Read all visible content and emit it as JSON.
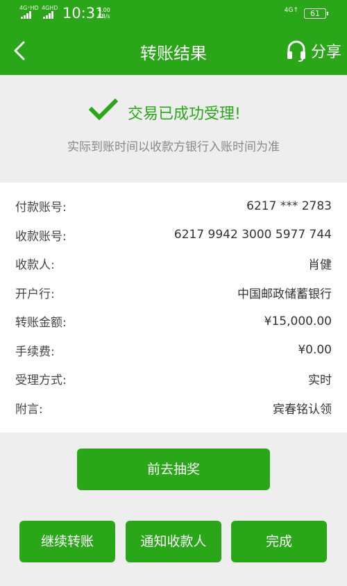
{
  "status_bar": {
    "net1": "4G⁺HD",
    "net2": "4GHD",
    "time": "10:31",
    "speed_value": "4.00",
    "speed_unit": "KB/s",
    "right_net": "4G↑",
    "battery": "61"
  },
  "nav": {
    "back_icon": "chevron-left-icon",
    "title": "转账结果",
    "share_icon": "headset-icon",
    "share_label": "分享"
  },
  "result": {
    "title": "交易已成功受理!",
    "subtitle": "实际到账时间以收款方银行入账时间为准",
    "status_color": "#2aa718"
  },
  "details": [
    {
      "label": "付款账号:",
      "value": "6217 *** 2783"
    },
    {
      "label": "收款账号:",
      "value": "6217 9942 3000 5977 744"
    },
    {
      "label": "收款人:",
      "value": "肖健"
    },
    {
      "label": "开户行:",
      "value": "中国邮政储蓄银行"
    },
    {
      "label": "转账金额:",
      "value": "¥15,000.00"
    },
    {
      "label": "手续费:",
      "value": "¥0.00"
    },
    {
      "label": "受理方式:",
      "value": "实时"
    },
    {
      "label": "附言:",
      "value": "宾春铭认领"
    }
  ],
  "buttons": {
    "lottery": "前去抽奖",
    "continue": "继续转账",
    "notify": "通知收款人",
    "done": "完成"
  }
}
